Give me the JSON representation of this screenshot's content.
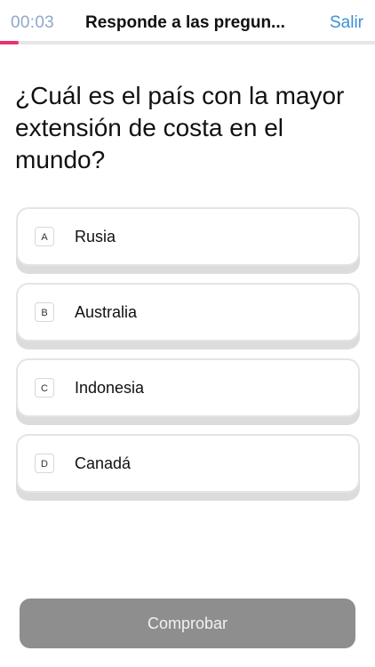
{
  "header": {
    "timer": "00:03",
    "title": "Responde a las pregun...",
    "exit_label": "Salir"
  },
  "progress": {
    "fraction": 0.05,
    "color": "#e8336f"
  },
  "question": {
    "text": "¿Cuál es el país con la mayor extensión de costa en el mundo?"
  },
  "options": [
    {
      "letter": "A",
      "label": "Rusia"
    },
    {
      "letter": "B",
      "label": "Australia"
    },
    {
      "letter": "C",
      "label": "Indonesia"
    },
    {
      "letter": "D",
      "label": "Canadá"
    }
  ],
  "footer": {
    "check_label": "Comprobar"
  },
  "colors": {
    "accent": "#3b8fd6",
    "progress": "#e8336f",
    "button_disabled": "#8e8e8e"
  }
}
